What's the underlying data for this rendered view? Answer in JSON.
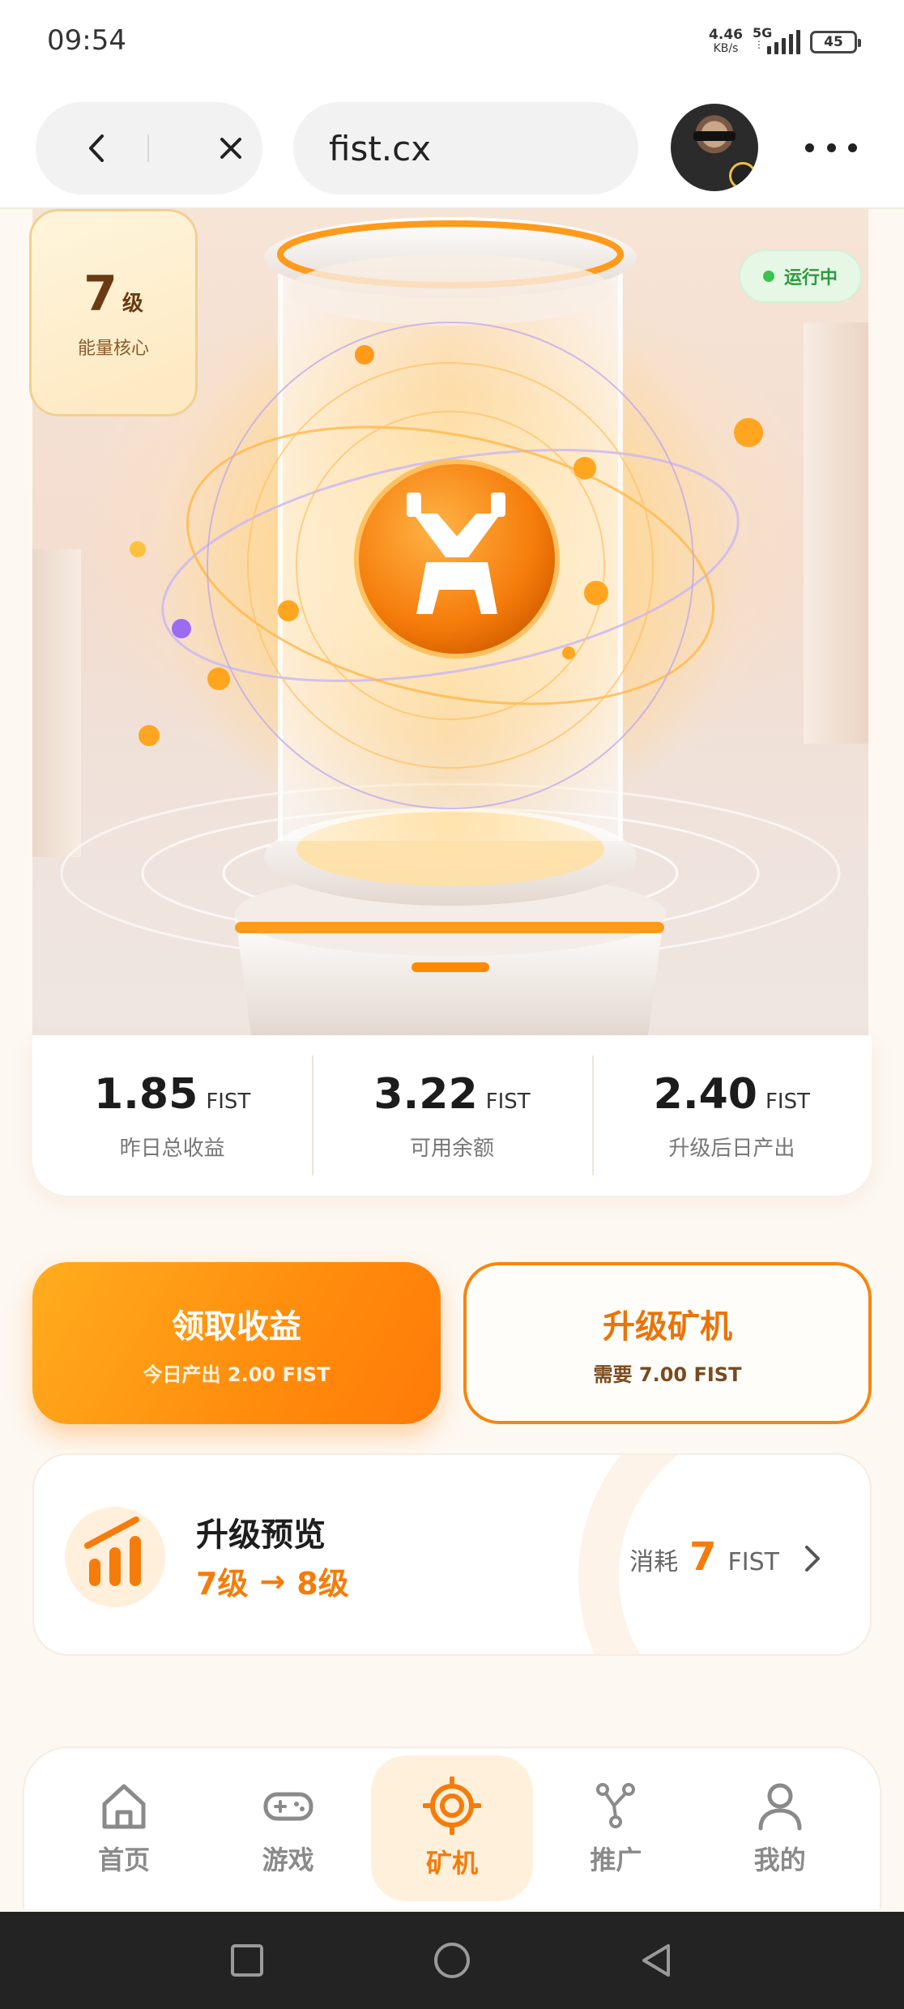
{
  "status_bar": {
    "time": "09:54",
    "net_speed": "4.46",
    "net_unit": "KB/s",
    "network": "5G",
    "battery": "45"
  },
  "browser": {
    "url": "fist.cx",
    "icons": [
      "back-icon",
      "close-icon",
      "more-icon"
    ]
  },
  "hero": {
    "level_number": "7",
    "level_unit": "级",
    "level_caption": "能量核心",
    "status": "运行中",
    "status_color": "#3cc34f",
    "accent": "#f57c0a"
  },
  "stats": [
    {
      "value": "1.85",
      "currency": "FIST",
      "label": "昨日总收益"
    },
    {
      "value": "3.22",
      "currency": "FIST",
      "label": "可用余额"
    },
    {
      "value": "2.40",
      "currency": "FIST",
      "label": "升级后日产出"
    }
  ],
  "actions": {
    "claim_title": "领取收益",
    "claim_sub": "今日产出 2.00 FIST",
    "upgrade_title": "升级矿机",
    "upgrade_sub": "需要 7.00 FIST"
  },
  "preview": {
    "title": "升级预览",
    "from_level": "7级",
    "arrow": "→",
    "to_level": "8级",
    "cost_label": "消耗",
    "cost_value": "7",
    "cost_currency": "FIST"
  },
  "bottom_nav": [
    {
      "label": "首页",
      "icon": "home-icon",
      "active": false
    },
    {
      "label": "游戏",
      "icon": "gamepad-icon",
      "active": false
    },
    {
      "label": "矿机",
      "icon": "target-icon",
      "active": true
    },
    {
      "label": "推广",
      "icon": "share-nodes-icon",
      "active": false
    },
    {
      "label": "我的",
      "icon": "user-icon",
      "active": false
    }
  ]
}
